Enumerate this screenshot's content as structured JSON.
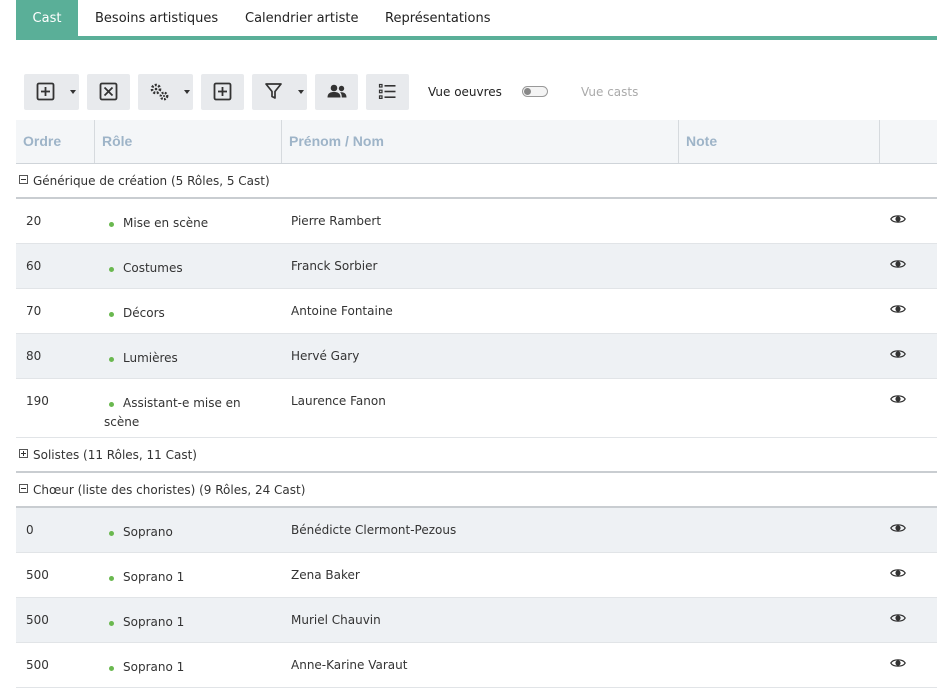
{
  "tabs": [
    {
      "label": "Cast",
      "active": true
    },
    {
      "label": "Besoins artistiques",
      "active": false
    },
    {
      "label": "Calendrier artiste",
      "active": false
    },
    {
      "label": "Représentations",
      "active": false
    }
  ],
  "toolbar": {
    "icons": [
      "add-square-icon",
      "close-square-icon",
      "gears-icon",
      "add-square-icon",
      "filter-icon",
      "users-icon",
      "list-icon"
    ],
    "vue_oeuvres": "Vue oeuvres",
    "vue_casts": "Vue casts",
    "toggle_on": false
  },
  "grid": {
    "columns": [
      "Ordre",
      "Rôle",
      "Prénom / Nom",
      "Note"
    ],
    "groups": [
      {
        "title": "Générique de création (5 Rôles, 5 Cast)",
        "expanded": true,
        "rows": [
          {
            "ordre": "20",
            "role": "Mise en scène",
            "nom": "Pierre Rambert"
          },
          {
            "ordre": "60",
            "role": "Costumes",
            "nom": "Franck Sorbier"
          },
          {
            "ordre": "70",
            "role": "Décors",
            "nom": "Antoine Fontaine"
          },
          {
            "ordre": "80",
            "role": "Lumières",
            "nom": "Hervé Gary"
          },
          {
            "ordre": "190",
            "role": "Assistant-e mise en scène",
            "nom": "Laurence Fanon"
          }
        ]
      },
      {
        "title": "Solistes (11 Rôles, 11 Cast)",
        "expanded": false,
        "rows": []
      },
      {
        "title": "Chœur (liste des choristes) (9 Rôles, 24 Cast)",
        "expanded": true,
        "rows": [
          {
            "ordre": "0",
            "role": "Soprano",
            "nom": "Bénédicte Clermont-Pezous"
          },
          {
            "ordre": "500",
            "role": "Soprano 1",
            "nom": "Zena Baker"
          },
          {
            "ordre": "500",
            "role": "Soprano 1",
            "nom": "Muriel Chauvin"
          },
          {
            "ordre": "500",
            "role": "Soprano 1",
            "nom": "Anne-Karine Varaut"
          }
        ]
      }
    ]
  },
  "colors": {
    "accent": "#5aaf98",
    "header_text": "#9eb4c8",
    "role_dot": "#6ab84f"
  }
}
